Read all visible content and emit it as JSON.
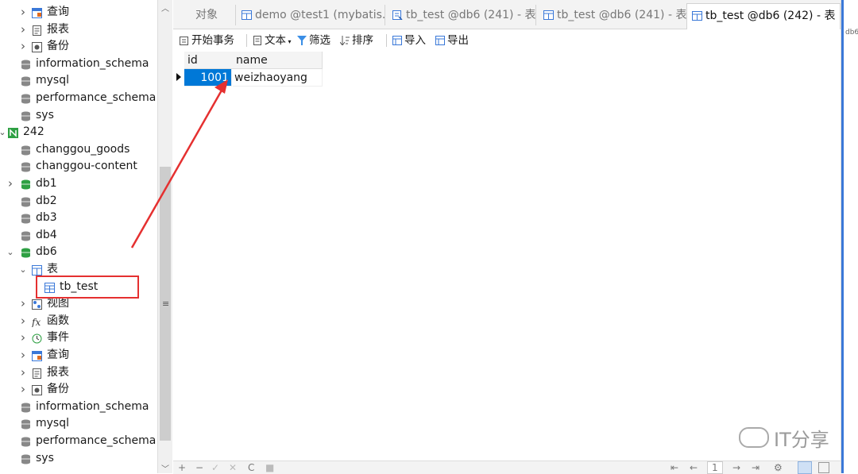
{
  "tree": {
    "items": [
      {
        "label": "查询",
        "icon": "query-icon",
        "arrow": ">",
        "indent": 1
      },
      {
        "label": "报表",
        "icon": "report-icon",
        "arrow": ">",
        "indent": 1
      },
      {
        "label": "备份",
        "icon": "backup-icon",
        "arrow": ">",
        "indent": 1
      },
      {
        "label": "information_schema",
        "icon": "database-icon",
        "arrow": "",
        "indent": 0
      },
      {
        "label": "mysql",
        "icon": "database-icon",
        "arrow": "",
        "indent": 0
      },
      {
        "label": "performance_schema",
        "icon": "database-icon",
        "arrow": "",
        "indent": 0
      },
      {
        "label": "sys",
        "icon": "database-icon",
        "arrow": "",
        "indent": 0
      },
      {
        "label": "242",
        "icon": "connection-icon",
        "arrow": "v",
        "indent": -1
      },
      {
        "label": "changgou_goods",
        "icon": "database-icon",
        "arrow": "",
        "indent": 0
      },
      {
        "label": "changgou-content",
        "icon": "database-icon",
        "arrow": "",
        "indent": 0
      },
      {
        "label": "db1",
        "icon": "database-open-icon",
        "arrow": ">",
        "indent": 0
      },
      {
        "label": "db2",
        "icon": "database-icon",
        "arrow": "",
        "indent": 0
      },
      {
        "label": "db3",
        "icon": "database-icon",
        "arrow": "",
        "indent": 0
      },
      {
        "label": "db4",
        "icon": "database-icon",
        "arrow": "",
        "indent": 0
      },
      {
        "label": "db6",
        "icon": "database-open-icon",
        "arrow": "v",
        "indent": 0
      },
      {
        "label": "表",
        "icon": "tables-icon",
        "arrow": "v",
        "indent": 1
      },
      {
        "label": "tb_test",
        "icon": "table-icon",
        "arrow": "",
        "indent": 2
      },
      {
        "label": "视图",
        "icon": "view-icon",
        "arrow": ">",
        "indent": 1
      },
      {
        "label": "函数",
        "icon": "function-icon",
        "arrow": ">",
        "indent": 1
      },
      {
        "label": "事件",
        "icon": "event-icon",
        "arrow": ">",
        "indent": 1
      },
      {
        "label": "查询",
        "icon": "query-icon",
        "arrow": ">",
        "indent": 1
      },
      {
        "label": "报表",
        "icon": "report-icon",
        "arrow": ">",
        "indent": 1
      },
      {
        "label": "备份",
        "icon": "backup-icon",
        "arrow": ">",
        "indent": 1
      },
      {
        "label": "information_schema",
        "icon": "database-icon",
        "arrow": "",
        "indent": 0
      },
      {
        "label": "mysql",
        "icon": "database-icon",
        "arrow": "",
        "indent": 0
      },
      {
        "label": "performance_schema",
        "icon": "database-icon",
        "arrow": "",
        "indent": 0
      },
      {
        "label": "sys",
        "icon": "database-icon",
        "arrow": "",
        "indent": 0
      }
    ]
  },
  "tabs": [
    {
      "label": "对象",
      "icon": ""
    },
    {
      "label": "demo @test1 (mybatis...",
      "icon": "table-icon"
    },
    {
      "label": "tb_test @db6 (241) - 表",
      "icon": "query-icon"
    },
    {
      "label": "tb_test @db6 (241) - 表",
      "icon": "table-icon"
    },
    {
      "label": "tb_test @db6 (242) - 表",
      "icon": "table-icon"
    }
  ],
  "tab_overflow": "db6",
  "toolbar": {
    "begin_tx": "开始事务",
    "text": "文本",
    "filter": "筛选",
    "sort": "排序",
    "import": "导入",
    "export": "导出"
  },
  "grid": {
    "columns": [
      "id",
      "name"
    ],
    "rows": [
      [
        "1001",
        "weizhaoyang"
      ]
    ]
  },
  "status": {
    "add": "+",
    "remove": "−",
    "apply": "✓",
    "discard": "✕",
    "refresh": "C",
    "stop": "■",
    "page": "1"
  },
  "watermark": "IT分享",
  "colors": {
    "accent": "#3a78d8",
    "selected_cell": "#0078d7",
    "annotation": "#e53030",
    "db_green": "#2ea043"
  }
}
